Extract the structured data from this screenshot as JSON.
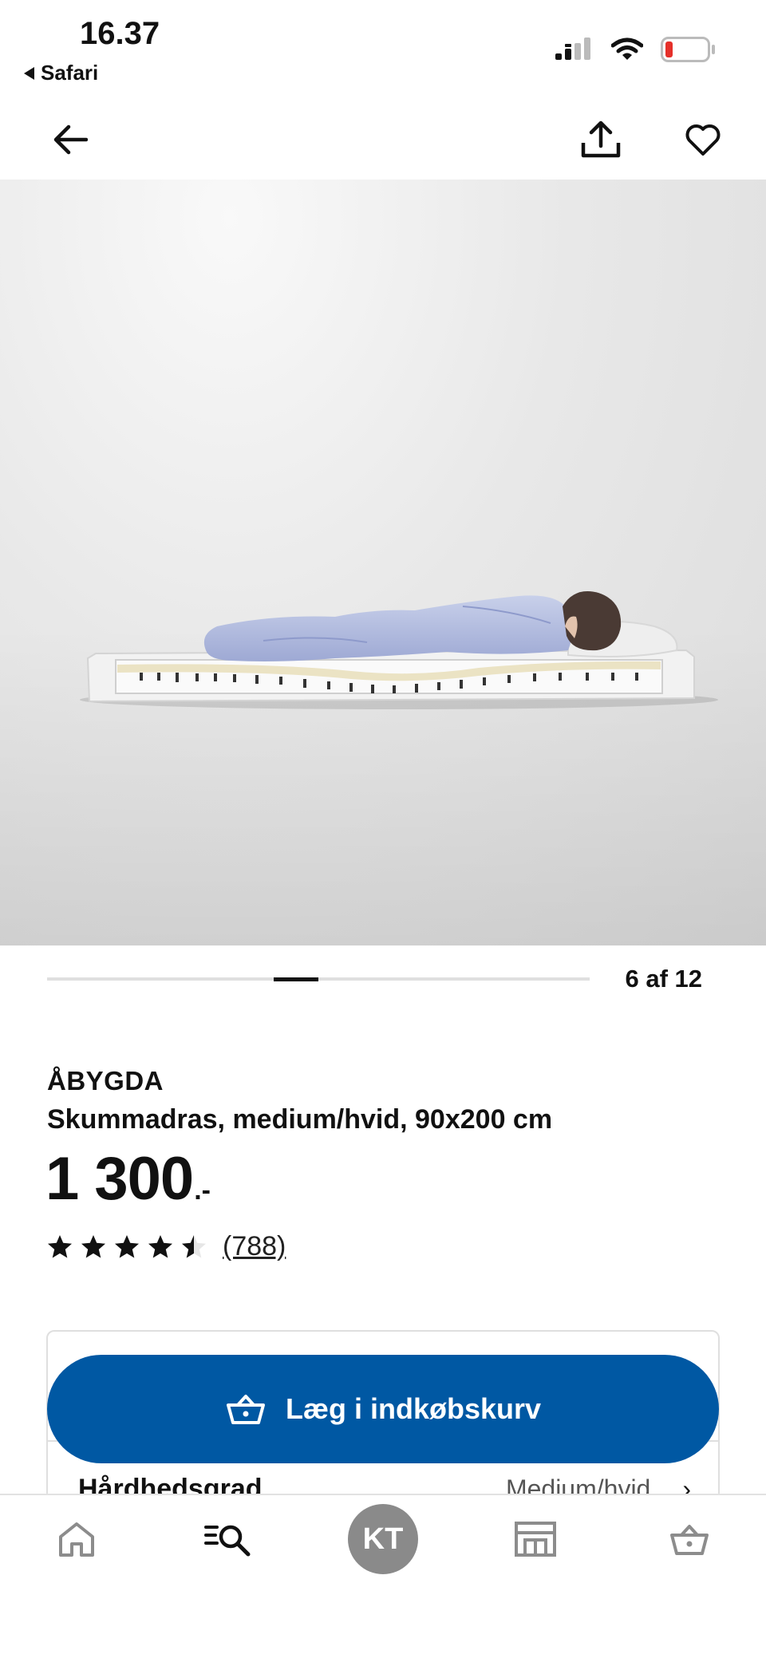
{
  "status_bar": {
    "time": "16.37",
    "back_app": "Safari"
  },
  "product": {
    "brand": "ÅBYGDA",
    "description": "Skummadras, medium/hvid, 90x200 cm",
    "price_main": "1 300",
    "price_suffix": ".-",
    "rating_value": 4.5,
    "rating_max": 5,
    "review_count": "(788)"
  },
  "carousel": {
    "counter": "6 af 12",
    "current": 6,
    "total": 12
  },
  "actions": {
    "add_to_cart": "Læg i indkøbskurv"
  },
  "option": {
    "label": "Hårdhedsgrad",
    "value": "Medium/hvid"
  },
  "tab_bar": {
    "avatar_initials": "KT",
    "items": [
      "home-icon",
      "search-icon",
      "profile-avatar",
      "store-icon",
      "basket-icon"
    ]
  },
  "colors": {
    "brand_blue": "#0058a3",
    "avatar_grey": "#8a8a8a",
    "battery_red": "#e5302a"
  }
}
